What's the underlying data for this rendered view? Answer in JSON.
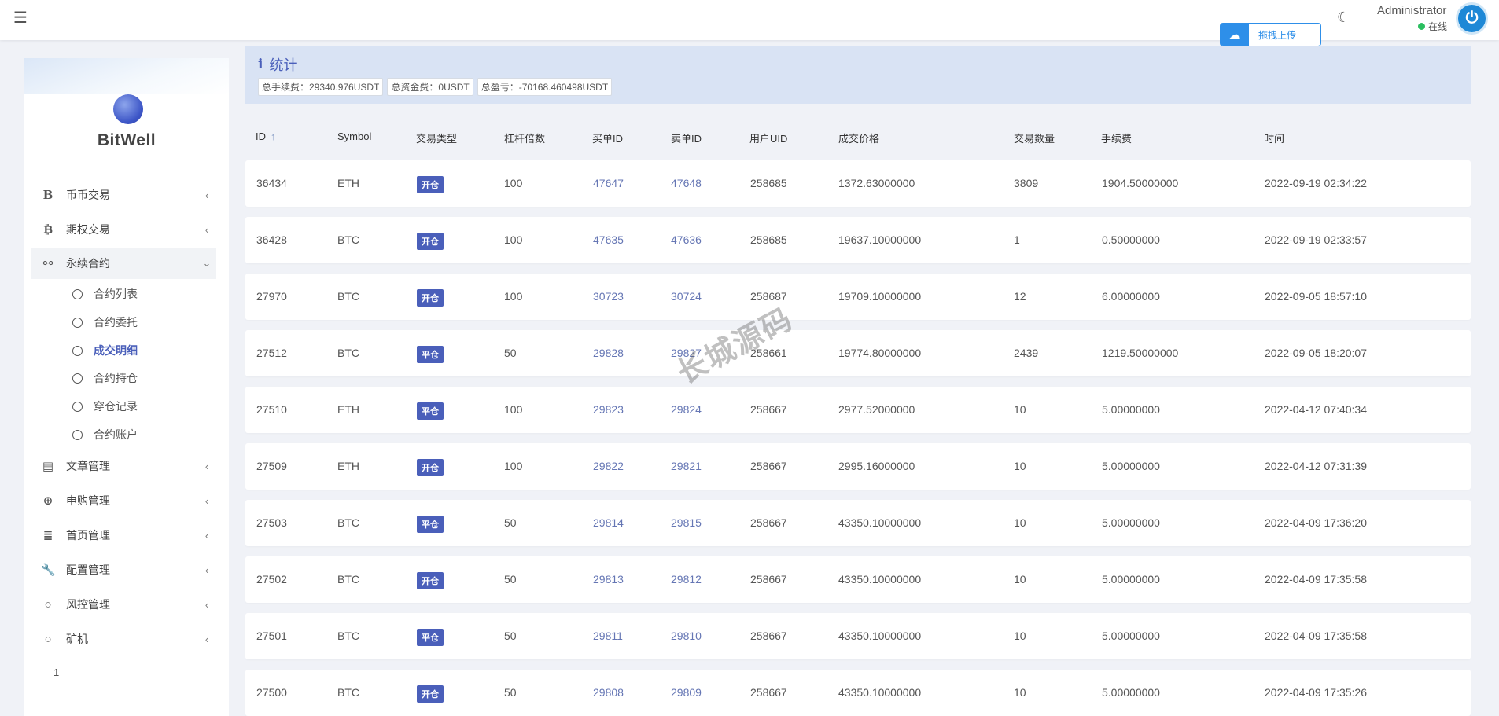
{
  "topbar": {
    "menu_icon": "hamburger-icon",
    "upload_label": "拖拽上传",
    "theme_icon": "moon-icon",
    "user_name": "Administrator",
    "user_status": "在线"
  },
  "sidebar": {
    "brand": "BitWell",
    "menu": [
      {
        "label": "币币交易",
        "icon": "bitwell-b-icon"
      },
      {
        "label": "期权交易",
        "icon": "bitcoin-icon"
      },
      {
        "label": "永续合约",
        "icon": "link-icon"
      },
      {
        "label": "文章管理",
        "icon": "newspaper-icon"
      },
      {
        "label": "申购管理",
        "icon": "lifebuoy-icon"
      },
      {
        "label": "首页管理",
        "icon": "list-icon"
      },
      {
        "label": "配置管理",
        "icon": "wrench-icon"
      },
      {
        "label": "风控管理",
        "icon": "circle-icon"
      },
      {
        "label": "矿机",
        "icon": "circle-icon"
      }
    ],
    "submenu": [
      {
        "label": "合约列表"
      },
      {
        "label": "合约委托"
      },
      {
        "label": "成交明细"
      },
      {
        "label": "合约持仓"
      },
      {
        "label": "穿仓记录"
      },
      {
        "label": "合约账户"
      }
    ],
    "page_number": "1"
  },
  "stats": {
    "title": "统计",
    "total_fee": "总手续费：29340.976USDT",
    "total_funding": "总资金费：0USDT",
    "total_pnl": "总盈亏：-70168.460498USDT"
  },
  "table": {
    "headers": {
      "id": "ID",
      "symbol": "Symbol",
      "type": "交易类型",
      "leverage": "杠杆倍数",
      "buy_id": "买单ID",
      "sell_id": "卖单ID",
      "uid": "用户UID",
      "price": "成交价格",
      "qty": "交易数量",
      "fee": "手续费",
      "time": "时间"
    },
    "sort_icon": "sort-up-arrow-icon",
    "rows": [
      {
        "id": "36434",
        "symbol": "ETH",
        "type": "开仓",
        "leverage": "100",
        "buy_id": "47647",
        "sell_id": "47648",
        "uid": "258685",
        "price": "1372.63000000",
        "qty": "3809",
        "fee": "1904.50000000",
        "time": "2022-09-19 02:34:22"
      },
      {
        "id": "36428",
        "symbol": "BTC",
        "type": "开仓",
        "leverage": "100",
        "buy_id": "47635",
        "sell_id": "47636",
        "uid": "258685",
        "price": "19637.10000000",
        "qty": "1",
        "fee": "0.50000000",
        "time": "2022-09-19 02:33:57"
      },
      {
        "id": "27970",
        "symbol": "BTC",
        "type": "开仓",
        "leverage": "100",
        "buy_id": "30723",
        "sell_id": "30724",
        "uid": "258687",
        "price": "19709.10000000",
        "qty": "12",
        "fee": "6.00000000",
        "time": "2022-09-05 18:57:10"
      },
      {
        "id": "27512",
        "symbol": "BTC",
        "type": "平仓",
        "leverage": "50",
        "buy_id": "29828",
        "sell_id": "29827",
        "uid": "258661",
        "price": "19774.80000000",
        "qty": "2439",
        "fee": "1219.50000000",
        "time": "2022-09-05 18:20:07"
      },
      {
        "id": "27510",
        "symbol": "ETH",
        "type": "平仓",
        "leverage": "100",
        "buy_id": "29823",
        "sell_id": "29824",
        "uid": "258667",
        "price": "2977.52000000",
        "qty": "10",
        "fee": "5.00000000",
        "time": "2022-04-12 07:40:34"
      },
      {
        "id": "27509",
        "symbol": "ETH",
        "type": "开仓",
        "leverage": "100",
        "buy_id": "29822",
        "sell_id": "29821",
        "uid": "258667",
        "price": "2995.16000000",
        "qty": "10",
        "fee": "5.00000000",
        "time": "2022-04-12 07:31:39"
      },
      {
        "id": "27503",
        "symbol": "BTC",
        "type": "平仓",
        "leverage": "50",
        "buy_id": "29814",
        "sell_id": "29815",
        "uid": "258667",
        "price": "43350.10000000",
        "qty": "10",
        "fee": "5.00000000",
        "time": "2022-04-09 17:36:20"
      },
      {
        "id": "27502",
        "symbol": "BTC",
        "type": "开仓",
        "leverage": "50",
        "buy_id": "29813",
        "sell_id": "29812",
        "uid": "258667",
        "price": "43350.10000000",
        "qty": "10",
        "fee": "5.00000000",
        "time": "2022-04-09 17:35:58"
      },
      {
        "id": "27501",
        "symbol": "BTC",
        "type": "平仓",
        "leverage": "50",
        "buy_id": "29811",
        "sell_id": "29810",
        "uid": "258667",
        "price": "43350.10000000",
        "qty": "10",
        "fee": "5.00000000",
        "time": "2022-04-09 17:35:58"
      },
      {
        "id": "27500",
        "symbol": "BTC",
        "type": "开仓",
        "leverage": "50",
        "buy_id": "29808",
        "sell_id": "29809",
        "uid": "258667",
        "price": "43350.10000000",
        "qty": "10",
        "fee": "5.00000000",
        "time": "2022-04-09 17:35:26"
      }
    ]
  },
  "watermark": "长城源码"
}
